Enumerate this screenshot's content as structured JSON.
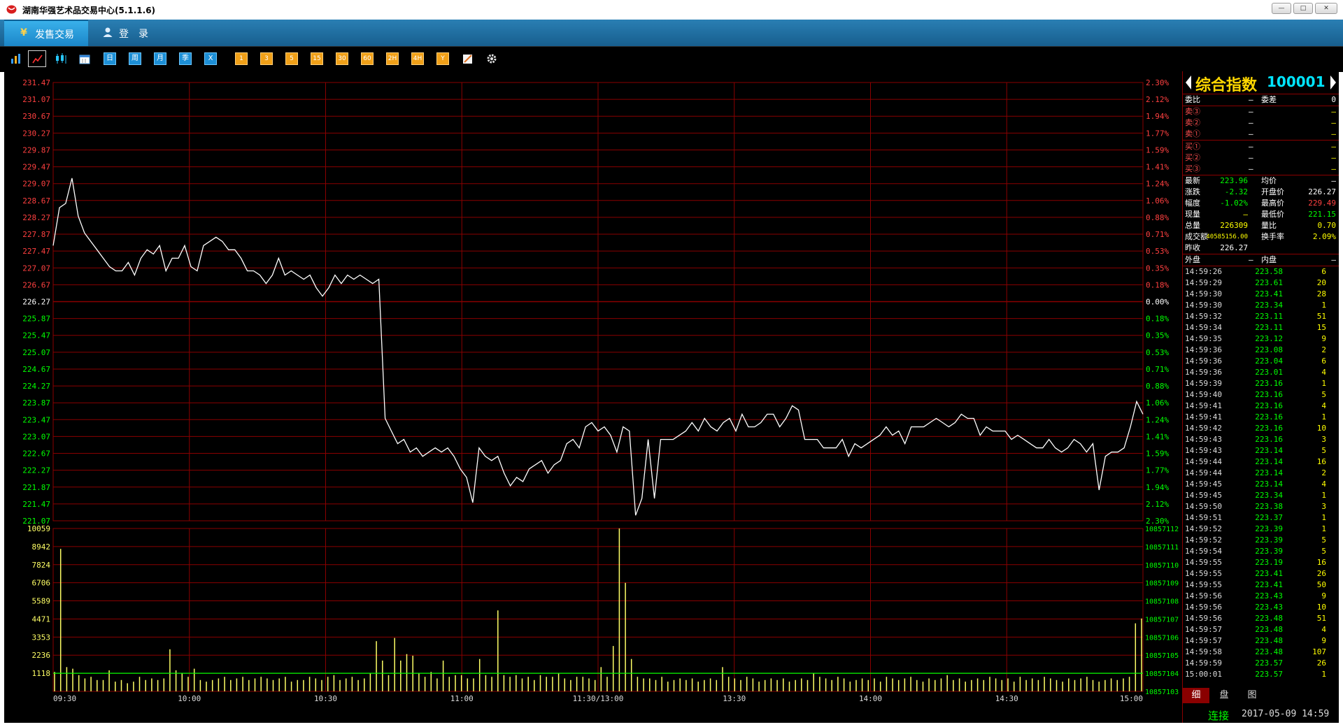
{
  "window": {
    "title": "湖南华强艺术品交易中心(5.1.1.6)",
    "min_label": "—",
    "max_label": "□",
    "close_label": "✕"
  },
  "tabs": {
    "sell": {
      "label": "发售交易",
      "icon": "yen-icon"
    },
    "login": {
      "label": "登录",
      "icon": "user-icon"
    }
  },
  "toolbar": {
    "buttons": [
      {
        "name": "bar-chart-icon",
        "label": "",
        "style": "icon"
      },
      {
        "name": "line-chart-icon",
        "label": "",
        "style": "icon",
        "selected": true
      },
      {
        "name": "candlestick-icon",
        "label": "",
        "style": "icon"
      },
      {
        "name": "calendar-icon",
        "label": "",
        "style": "icon"
      },
      {
        "name": "period-day",
        "label": "日",
        "style": "blue"
      },
      {
        "name": "period-week",
        "label": "周",
        "style": "blue"
      },
      {
        "name": "period-month",
        "label": "月",
        "style": "blue"
      },
      {
        "name": "period-season",
        "label": "季",
        "style": "blue"
      },
      {
        "name": "period-x",
        "label": "X",
        "style": "blue"
      },
      {
        "name": "min-1",
        "label": "1",
        "style": "orange"
      },
      {
        "name": "min-3",
        "label": "3",
        "style": "orange"
      },
      {
        "name": "min-5",
        "label": "5",
        "style": "orange"
      },
      {
        "name": "min-15",
        "label": "15",
        "style": "orange"
      },
      {
        "name": "min-30",
        "label": "30",
        "style": "orange"
      },
      {
        "name": "min-60",
        "label": "60",
        "style": "orange"
      },
      {
        "name": "hour-2",
        "label": "2H",
        "style": "orange"
      },
      {
        "name": "hour-4",
        "label": "4H",
        "style": "orange"
      },
      {
        "name": "year",
        "label": "Y",
        "style": "orange"
      },
      {
        "name": "draw-icon",
        "label": "",
        "style": "icon"
      },
      {
        "name": "gear-icon",
        "label": "",
        "style": "icon"
      }
    ]
  },
  "chart_data": {
    "type": "line",
    "title": "",
    "price_ticks": [
      "231.47",
      "231.07",
      "230.67",
      "230.27",
      "229.87",
      "229.47",
      "229.07",
      "228.67",
      "228.27",
      "227.87",
      "227.47",
      "227.07",
      "226.67",
      "226.27",
      "225.87",
      "225.47",
      "225.07",
      "224.67",
      "224.27",
      "223.87",
      "223.47",
      "223.07",
      "222.67",
      "222.27",
      "221.87",
      "221.47",
      "221.07"
    ],
    "pct_ticks": [
      "2.30%",
      "2.12%",
      "1.94%",
      "1.77%",
      "1.59%",
      "1.41%",
      "1.24%",
      "1.06%",
      "0.88%",
      "0.71%",
      "0.53%",
      "0.35%",
      "0.18%",
      "0.00%",
      "0.18%",
      "0.35%",
      "0.53%",
      "0.71%",
      "0.88%",
      "1.06%",
      "1.24%",
      "1.41%",
      "1.59%",
      "1.77%",
      "1.94%",
      "2.12%",
      "2.30%"
    ],
    "ylim": [
      221.07,
      231.47
    ],
    "prev_close": 226.27,
    "vol_ticks_left": [
      "10059",
      "8942",
      "7824",
      "6706",
      "5589",
      "4471",
      "3353",
      "2236",
      "1118"
    ],
    "vol_ticks_right": [
      "10857112",
      "10857111",
      "10857110",
      "10857109",
      "10857108",
      "10857107",
      "10857106",
      "10857105",
      "10857104",
      "10857103"
    ],
    "vol_max": 10059,
    "x_ticks": [
      "09:30",
      "10:00",
      "10:30",
      "11:00",
      "11:30/13:00",
      "13:30",
      "14:00",
      "14:30",
      "15:00"
    ],
    "series": [
      {
        "values": [
          227.6,
          228.5,
          228.6,
          229.2,
          228.3,
          227.9,
          227.7,
          227.5,
          227.3,
          227.1,
          227.0,
          227.0,
          227.2,
          226.9,
          227.3,
          227.5,
          227.4,
          227.6,
          227.0,
          227.3,
          227.3,
          227.6,
          227.1,
          227.0,
          227.6,
          227.7,
          227.8,
          227.7,
          227.5,
          227.5,
          227.3,
          227.0,
          227.0,
          226.9,
          226.7,
          226.9,
          227.3,
          226.9,
          227.0,
          226.9,
          226.8,
          226.9,
          226.6,
          226.4,
          226.6,
          226.9,
          226.7,
          226.9,
          226.8,
          226.9,
          226.8,
          226.7,
          226.8,
          223.5,
          223.2,
          222.9,
          223.0,
          222.7,
          222.8,
          222.6,
          222.7,
          222.8,
          222.7,
          222.8,
          222.6,
          222.3,
          222.1,
          221.5,
          222.8,
          222.6,
          222.5,
          222.6,
          222.2,
          221.9,
          222.1,
          222.0,
          222.3,
          222.4,
          222.5,
          222.2,
          222.4,
          222.5,
          222.9,
          223.0,
          222.8,
          223.3,
          223.4,
          223.2,
          223.3,
          223.1,
          222.7,
          223.3,
          223.2,
          221.2,
          221.6,
          223.0,
          221.6,
          223.0,
          223.0,
          223.0,
          223.1,
          223.2,
          223.4,
          223.2,
          223.5,
          223.3,
          223.2,
          223.4,
          223.5,
          223.2,
          223.6,
          223.3,
          223.3,
          223.4,
          223.6,
          223.6,
          223.3,
          223.5,
          223.8,
          223.7,
          223.0,
          223.0,
          223.0,
          222.8,
          222.8,
          222.8,
          223.0,
          222.6,
          222.9,
          222.8,
          222.9,
          223.0,
          223.1,
          223.3,
          223.1,
          223.2,
          222.9,
          223.3,
          223.3,
          223.3,
          223.4,
          223.5,
          223.4,
          223.3,
          223.4,
          223.6,
          223.5,
          223.5,
          223.1,
          223.3,
          223.2,
          223.2,
          223.2,
          223.0,
          223.1,
          223.0,
          222.9,
          222.8,
          222.8,
          223.0,
          222.8,
          222.7,
          222.8,
          223.0,
          222.9,
          222.7,
          222.9,
          221.8,
          222.6,
          222.7,
          222.7,
          222.8,
          223.3,
          223.9,
          223.6
        ]
      }
    ],
    "volume": [
      1200,
      8800,
      1500,
      1400,
      1000,
      800,
      900,
      700,
      700,
      1300,
      600,
      700,
      500,
      600,
      900,
      700,
      800,
      700,
      800,
      2600,
      1300,
      1100,
      900,
      1400,
      700,
      600,
      700,
      800,
      900,
      700,
      800,
      900,
      700,
      800,
      900,
      800,
      700,
      800,
      900,
      600,
      700,
      700,
      900,
      800,
      700,
      900,
      1000,
      700,
      800,
      900,
      700,
      800,
      1100,
      3100,
      1900,
      1000,
      3300,
      1900,
      2300,
      2200,
      1100,
      900,
      1200,
      800,
      1900,
      900,
      1000,
      1000,
      800,
      800,
      2000,
      1000,
      900,
      5000,
      1000,
      900,
      1000,
      800,
      900,
      700,
      1000,
      900,
      900,
      1100,
      800,
      700,
      900,
      900,
      800,
      700,
      1500,
      900,
      2800,
      10059,
      6700,
      2000,
      900,
      800,
      800,
      700,
      900,
      600,
      700,
      800,
      700,
      800,
      600,
      700,
      800,
      700,
      1500,
      900,
      800,
      700,
      900,
      800,
      600,
      700,
      800,
      700,
      800,
      600,
      700,
      800,
      700,
      1100,
      900,
      800,
      700,
      900,
      800,
      600,
      700,
      800,
      700,
      800,
      600,
      900,
      800,
      700,
      800,
      900,
      700,
      600,
      800,
      700,
      800,
      1000,
      700,
      800,
      600,
      700,
      800,
      700,
      900,
      800,
      700,
      800,
      600,
      900,
      700,
      800,
      700,
      900,
      800,
      700,
      600,
      800,
      700,
      800,
      900,
      700,
      600,
      700,
      800,
      700,
      800,
      900,
      4200,
      4500
    ],
    "legend": "none"
  },
  "panel": {
    "title": "综合指数",
    "code": "100001",
    "weibi": {
      "label": "委比",
      "value": "—"
    },
    "weicha": {
      "label": "委差",
      "value": "0"
    },
    "sell": [
      {
        "label": "卖③",
        "price": "—",
        "vol": "—"
      },
      {
        "label": "卖②",
        "price": "—",
        "vol": "—"
      },
      {
        "label": "卖①",
        "price": "—",
        "vol": "—"
      }
    ],
    "buy": [
      {
        "label": "买①",
        "price": "—",
        "vol": "—"
      },
      {
        "label": "买②",
        "price": "—",
        "vol": "—"
      },
      {
        "label": "买③",
        "price": "—",
        "vol": "—"
      }
    ],
    "quote": [
      {
        "l1": "最新",
        "v1": "223.96",
        "c1": "#00ff00",
        "l2": "均价",
        "v2": "—",
        "c2": "#ffffff"
      },
      {
        "l1": "涨跌",
        "v1": "-2.32",
        "c1": "#00ff00",
        "l2": "开盘价",
        "v2": "226.27",
        "c2": "#ffffff"
      },
      {
        "l1": "幅度",
        "v1": "-1.02%",
        "c1": "#00ff00",
        "l2": "最高价",
        "v2": "229.49",
        "c2": "#ff4040"
      },
      {
        "l1": "现量",
        "v1": "—",
        "c1": "#ffff00",
        "l2": "最低价",
        "v2": "221.15",
        "c2": "#00ff00"
      },
      {
        "l1": "总量",
        "v1": "226309",
        "c1": "#ffff00",
        "l2": "量比",
        "v2": "0.70",
        "c2": "#ffff00"
      },
      {
        "l1": "成交额",
        "v1": "40585156.00",
        "c1": "#ffff00",
        "l2": "换手率",
        "v2": "2.09%",
        "c2": "#ffff00"
      },
      {
        "l1": "昨收",
        "v1": "226.27",
        "c1": "#ffffff",
        "l2": "",
        "v2": "",
        "c2": "#ffffff"
      }
    ],
    "outer": {
      "label": "外盘",
      "value": "—"
    },
    "inner": {
      "label": "内盘",
      "value": "—"
    },
    "trades": [
      [
        "14:59:26",
        "223.58",
        "6"
      ],
      [
        "14:59:29",
        "223.61",
        "20"
      ],
      [
        "14:59:30",
        "223.41",
        "28"
      ],
      [
        "14:59:30",
        "223.34",
        "1"
      ],
      [
        "14:59:32",
        "223.11",
        "51"
      ],
      [
        "14:59:34",
        "223.11",
        "15"
      ],
      [
        "14:59:35",
        "223.12",
        "9"
      ],
      [
        "14:59:36",
        "223.08",
        "2"
      ],
      [
        "14:59:36",
        "223.04",
        "6"
      ],
      [
        "14:59:36",
        "223.01",
        "4"
      ],
      [
        "14:59:39",
        "223.16",
        "1"
      ],
      [
        "14:59:40",
        "223.16",
        "5"
      ],
      [
        "14:59:41",
        "223.16",
        "4"
      ],
      [
        "14:59:41",
        "223.16",
        "1"
      ],
      [
        "14:59:42",
        "223.16",
        "10"
      ],
      [
        "14:59:43",
        "223.16",
        "3"
      ],
      [
        "14:59:43",
        "223.14",
        "5"
      ],
      [
        "14:59:44",
        "223.14",
        "16"
      ],
      [
        "14:59:44",
        "223.14",
        "2"
      ],
      [
        "14:59:45",
        "223.14",
        "4"
      ],
      [
        "14:59:45",
        "223.34",
        "1"
      ],
      [
        "14:59:50",
        "223.38",
        "3"
      ],
      [
        "14:59:51",
        "223.37",
        "1"
      ],
      [
        "14:59:52",
        "223.39",
        "1"
      ],
      [
        "14:59:52",
        "223.39",
        "5"
      ],
      [
        "14:59:54",
        "223.39",
        "5"
      ],
      [
        "14:59:55",
        "223.19",
        "16"
      ],
      [
        "14:59:55",
        "223.41",
        "26"
      ],
      [
        "14:59:55",
        "223.41",
        "50"
      ],
      [
        "14:59:56",
        "223.43",
        "9"
      ],
      [
        "14:59:56",
        "223.43",
        "10"
      ],
      [
        "14:59:56",
        "223.48",
        "51"
      ],
      [
        "14:59:57",
        "223.48",
        "4"
      ],
      [
        "14:59:57",
        "223.48",
        "9"
      ],
      [
        "14:59:58",
        "223.48",
        "107"
      ],
      [
        "14:59:59",
        "223.57",
        "26"
      ],
      [
        "15:00:01",
        "223.57",
        "1"
      ]
    ],
    "tabs": [
      "细",
      "盘",
      "图"
    ],
    "status": {
      "connection": "连接",
      "datetime": "2017-05-09 14:59"
    }
  },
  "colors": {
    "grid": "#8a0000",
    "price_line": "#ffffff",
    "up": "#ff4040",
    "down": "#00ff00",
    "volume_bar": "#ffff66",
    "vol_avg_line": "#00ff00",
    "accent": "#ffd700"
  }
}
